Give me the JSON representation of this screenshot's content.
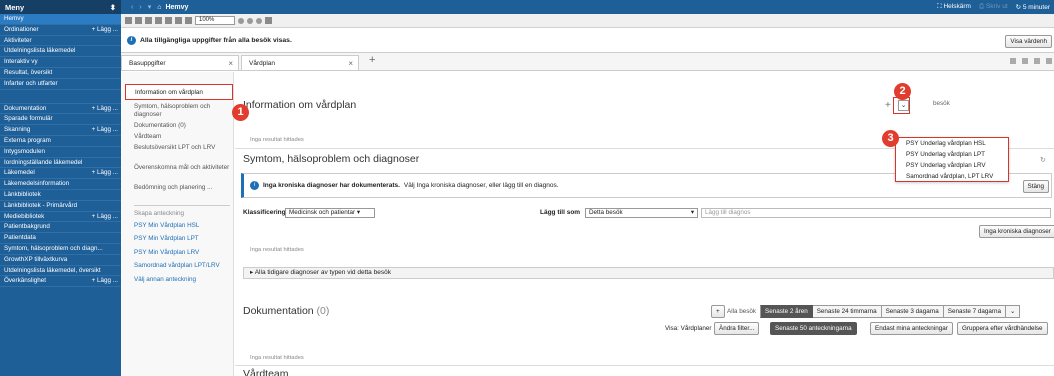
{
  "menu": {
    "title": "Meny",
    "items": [
      {
        "label": "Hemvy",
        "active": true,
        "add": ""
      },
      {
        "label": "Ordinationer",
        "add": "+ Lägg ..."
      },
      {
        "label": "Aktiviteter",
        "add": ""
      },
      {
        "label": "Utdelningslista läkemedel",
        "add": ""
      },
      {
        "label": "Interaktiv vy",
        "add": ""
      },
      {
        "label": "Resultat, översikt",
        "add": ""
      },
      {
        "label": "Infarter och utfarter",
        "add": ""
      },
      {
        "label": "",
        "add": "",
        "gap": true
      },
      {
        "label": "Dokumentation",
        "add": "+ Lägg ..."
      },
      {
        "label": "Sparade formulär",
        "add": ""
      },
      {
        "label": "Skanning",
        "add": "+ Lägg ..."
      },
      {
        "label": "Externa program",
        "add": ""
      },
      {
        "label": "Intygsmodulen",
        "add": ""
      },
      {
        "label": "Iordningställande läkemedel",
        "add": ""
      },
      {
        "label": "Läkemedel",
        "add": "+ Lägg ..."
      },
      {
        "label": "Läkemedelsinformation",
        "add": ""
      },
      {
        "label": "Länkbibliotek",
        "add": ""
      },
      {
        "label": "Länkbibliotek - Primärvård",
        "add": ""
      },
      {
        "label": "Mediebibliotek",
        "add": "+ Lägg ..."
      },
      {
        "label": "Patientbakgrund",
        "add": ""
      },
      {
        "label": "Patientdata",
        "add": ""
      },
      {
        "label": "Symtom, hälsoproblem och diagn...",
        "add": ""
      },
      {
        "label": "GrowthXP tillväxtkurva",
        "add": ""
      },
      {
        "label": "Utdelningslista läkemedel, översikt",
        "add": ""
      },
      {
        "label": "Överkänslighet",
        "add": "+ Lägg ..."
      }
    ]
  },
  "topbar": {
    "home": "Hemvy",
    "fullscreen": "Helskärm",
    "print": "Skriv ut",
    "refresh": "5 minuter"
  },
  "toolbar": {
    "zoom": "100%"
  },
  "infobar": {
    "text": "Alla tillgängliga uppgifter från alla besök visas.",
    "button": "Visa värdenh"
  },
  "tabs": [
    {
      "label": "Basuppgifter"
    },
    {
      "label": "Vårdplan"
    }
  ],
  "midnav": {
    "selected": "Information om vårdplan",
    "items": [
      "Symtom, hälsoproblem och diagnoser",
      "Dokumentation (0)",
      "Vårdteam",
      "Beslutsöversikt LPT och LRV",
      "Överenskomna mål och aktiviteter",
      "Bedömning och planering ..."
    ],
    "create_caption": "Skapa anteckning",
    "links": [
      "PSY Min Vårdplan HSL",
      "PSY Min Vårdplan LPT",
      "PSY Min Vårdplan LRV",
      "Samordnad vårdplan LPT/LRV",
      "Välj annan anteckning"
    ]
  },
  "main": {
    "info_title": "Information om vårdplan",
    "no_results": "Inga resultat hittades",
    "besok": "besök",
    "symptom_title": "Symtom, hälsoproblem och diagnoser",
    "warn_bold": "Inga kroniska diagnoser har dokumenterats.",
    "warn_text": "Välj Inga kroniska diagnoser, eller lägg till en diagnos.",
    "close_btn": "Stäng",
    "class_label": "Klassificering",
    "class_value": "Medicinsk och patientar",
    "add_as_label": "Lägg till som",
    "add_as_value": "Detta besök",
    "diag_placeholder": "Lägg till diagnos",
    "no_chronic_btn": "Inga kroniska diagnoser",
    "expander": "Alla tidigare diagnoser av typen vid detta besök",
    "doc_title": "Dokumentation",
    "doc_count": "(0)",
    "all_visits": "Alla besök",
    "segments": [
      "Senaste 2 åren",
      "Senaste 24 timmarna",
      "Senaste 3 dagarna",
      "Senaste 7 dagarna"
    ],
    "show_label": "Visa: Vårdplaner",
    "change_filter": "Ändra filter...",
    "last50": "Senaste 50 anteckningarna",
    "only_mine": "Endast mina anteckningar",
    "group_by": "Gruppera efter vårdhändelse",
    "team_title": "Vårdteam"
  },
  "dropdown": {
    "items": [
      "PSY Underlag vårdplan HSL",
      "PSY Underlag vårdplan LPT",
      "PSY Underlag vårdplan LRV",
      "Samordnad vårdplan, LPT LRV"
    ]
  },
  "badges": [
    "1",
    "2",
    "3"
  ],
  "colors": {
    "menu_bg": "#1f5f98",
    "highlight": "#d9342b",
    "badge": "#e13c2e"
  }
}
